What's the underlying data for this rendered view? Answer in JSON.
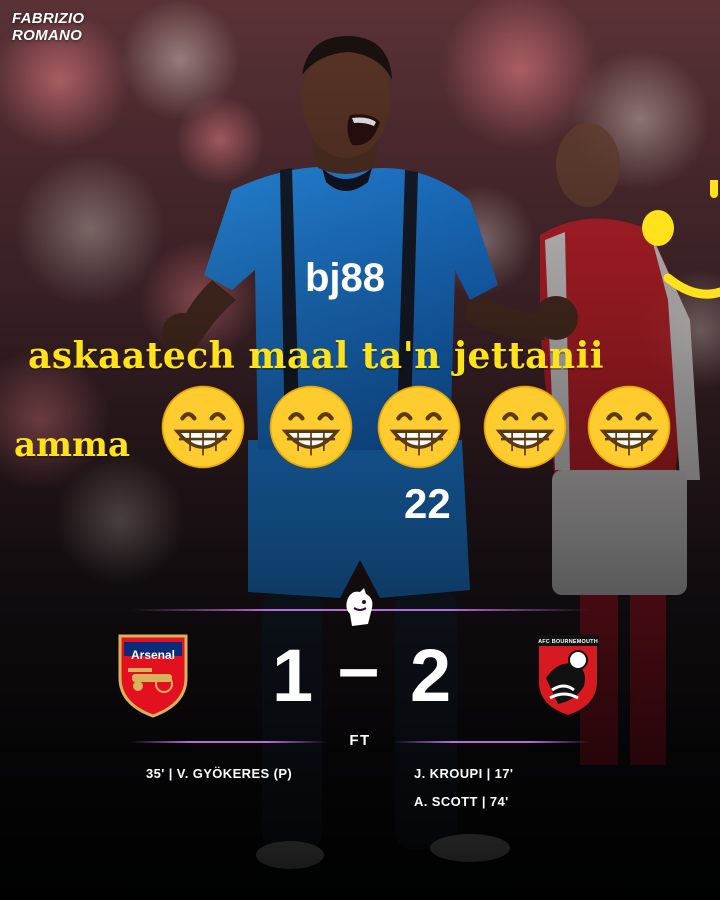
{
  "watermark": {
    "line1": "FABRIZIO",
    "line2": "ROMANO"
  },
  "caption": {
    "line1": "askaatech maal ta'n jettanii",
    "line2": "amma"
  },
  "emoji": [
    "grinning-face-with-smiling-eyes",
    "grinning-face-with-smiling-eyes",
    "grinning-face-with-smiling-eyes",
    "grinning-face-with-smiling-eyes",
    "grinning-face-with-smiling-eyes"
  ],
  "shirt": {
    "sponsor": "bj88",
    "number": "22"
  },
  "match": {
    "home": {
      "crest_text": "Arsenal",
      "score": "1"
    },
    "separator": "–",
    "away": {
      "crest_text": "AFC BOURNEMOUTH",
      "score": "2"
    },
    "status": "FT",
    "home_scorers": [
      "35'  |  V. GYÖKERES (P)"
    ],
    "away_scorers": [
      "J. KROUPI  |  17'",
      "A. SCOTT  |  74'"
    ]
  },
  "colors": {
    "caption_yellow": "#ffe21a",
    "divider_purple": "#b56bd4",
    "arsenal_red": "#e3101f",
    "bournemouth_red": "#d71920",
    "kit_blue": "#1f7fe0"
  }
}
